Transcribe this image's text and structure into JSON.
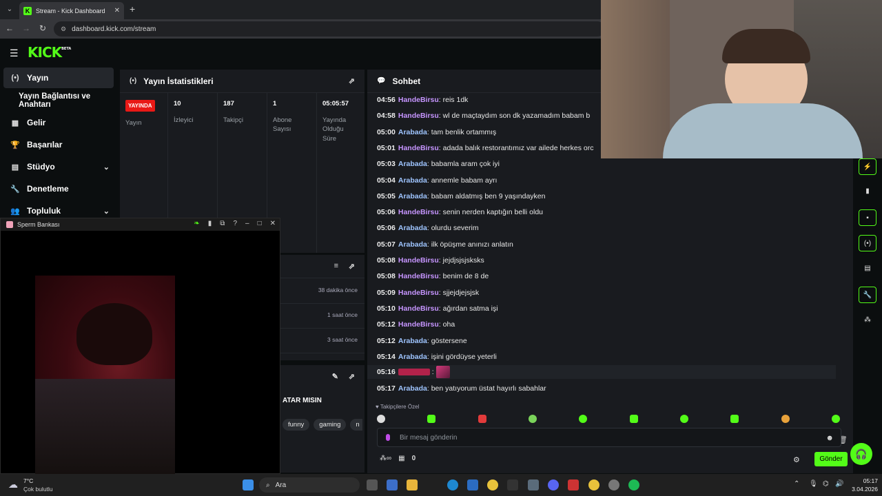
{
  "browser": {
    "tab_title": "Stream - Kick Dashboard",
    "url": "dashboard.kick.com/stream"
  },
  "brand": {
    "logo_text": "KICK",
    "logo_badge": "BETA"
  },
  "sidebar": {
    "items": [
      {
        "label": "Yayın"
      },
      {
        "label": "Yayın Bağlantısı ve Anahtarı"
      },
      {
        "label": "Gelir"
      },
      {
        "label": "Başarılar"
      },
      {
        "label": "Stüdyo"
      },
      {
        "label": "Denetleme"
      },
      {
        "label": "Topluluk"
      }
    ]
  },
  "stats": {
    "title": "Yayın İstatistikleri",
    "live_badge": "YAYINDA",
    "live_label": "Yayın",
    "columns": [
      {
        "value": "10",
        "label": "İzleyici"
      },
      {
        "value": "187",
        "label": "Takipçi"
      },
      {
        "value": "1",
        "label": "Abone Sayısı"
      },
      {
        "value": "05:05:57",
        "label": "Yayında Olduğu Süre"
      }
    ]
  },
  "activity": {
    "times": [
      "38 dakika önce",
      "1 saat önce",
      "3 saat önce"
    ]
  },
  "stream_info": {
    "title_fragment": "ATAR MISIN",
    "tags": [
      "funny",
      "gaming"
    ],
    "tag_more": "n"
  },
  "chat": {
    "title": "Sohbet",
    "messages": [
      {
        "time": "04:56",
        "user": "HandeBirsu",
        "text": "reis 1dk"
      },
      {
        "time": "04:58",
        "user": "HandeBirsu",
        "text": "wl de maçtaydım son dk yazamadım babam b"
      },
      {
        "time": "05:00",
        "user": "Arabada",
        "text": "tam benlik ortammış"
      },
      {
        "time": "05:01",
        "user": "HandeBirsu",
        "text": "adada balık restorantımız var ailede herkes orc"
      },
      {
        "time": "05:03",
        "user": "Arabada",
        "text": "babamla aram çok iyi"
      },
      {
        "time": "05:04",
        "user": "Arabada",
        "text": "annemle babam ayrı"
      },
      {
        "time": "05:05",
        "user": "Arabada",
        "text": "babam aldatmış ben 9 yaşındayken"
      },
      {
        "time": "05:06",
        "user": "HandeBirsu",
        "text": "senin nerden kaptığın belli oldu"
      },
      {
        "time": "05:06",
        "user": "Arabada",
        "text": "olurdu severim"
      },
      {
        "time": "05:07",
        "user": "Arabada",
        "text": "ilk öpüşme anınızı anlatın"
      },
      {
        "time": "05:08",
        "user": "HandeBirsu",
        "text": "jejdjsjsjsksks"
      },
      {
        "time": "05:08",
        "user": "HandeBirsu",
        "text": "benim de 8 de"
      },
      {
        "time": "05:09",
        "user": "HandeBirsu",
        "text": "sjjejdjejsjsk"
      },
      {
        "time": "05:10",
        "user": "HandeBirsu",
        "text": "ağırdan satma işi"
      },
      {
        "time": "05:12",
        "user": "HandeBirsu",
        "text": "oha"
      },
      {
        "time": "05:12",
        "user": "Arabada",
        "text": "göstersene"
      },
      {
        "time": "05:14",
        "user": "Arabada",
        "text": "işini gördüyse yeterli"
      },
      {
        "time": "05:16",
        "user": "",
        "text": ""
      },
      {
        "time": "05:17",
        "user": "Arabada",
        "text": "ben yatıyorum üstat hayırlı sabahlar"
      }
    ],
    "followers_only": "Takipçilere Özel",
    "input_placeholder": "Bir mesaj gönderin",
    "points": "0",
    "send_label": "Gönder",
    "colors": {
      "HandeBirsu": "#c695ff",
      "Arabada": "#9fc5ff",
      "accent": "#53fc18"
    }
  },
  "overlay_window": {
    "title": "Sperm Bankası"
  },
  "taskbar": {
    "weather_temp": "7°C",
    "weather_desc": "Çok bulutlu",
    "search_label": "Ara",
    "clock_time": "05:17",
    "clock_date": "3.04.2026"
  }
}
